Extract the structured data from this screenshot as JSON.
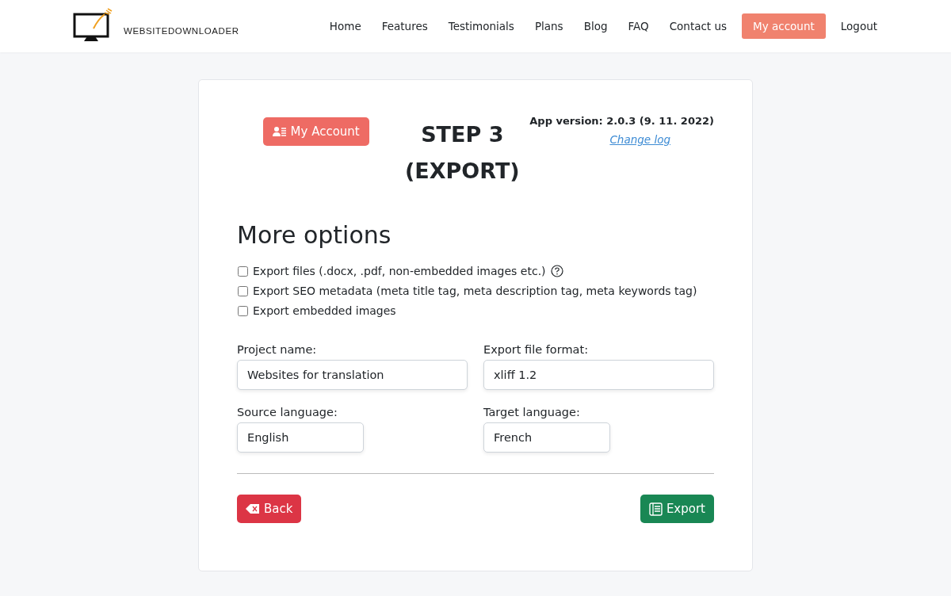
{
  "nav": {
    "logo_text": "WEBSITEDOWNLOADER",
    "links": [
      {
        "label": "Home",
        "selected": false
      },
      {
        "label": "Features",
        "selected": false
      },
      {
        "label": "Testimonials",
        "selected": false
      },
      {
        "label": "Plans",
        "selected": false
      },
      {
        "label": "Blog",
        "selected": false
      },
      {
        "label": "FAQ",
        "selected": false
      },
      {
        "label": "Contact us",
        "selected": false
      },
      {
        "label": "My account",
        "selected": true
      },
      {
        "label": "Logout",
        "selected": false
      }
    ]
  },
  "header": {
    "account_button": "My Account",
    "title": "STEP 3 (EXPORT)",
    "version": "App version: 2.0.3 (9. 11. 2022)",
    "changelog_link": "Change log"
  },
  "heading": "More options",
  "options": [
    {
      "label": "Export files (.docx, .pdf, non-embedded images etc.)",
      "checked": false,
      "help": true
    },
    {
      "label": "Export SEO metadata (meta title tag, meta description tag, meta keywords tag)",
      "checked": false,
      "help": false
    },
    {
      "label": "Export embedded images",
      "checked": false,
      "help": false
    }
  ],
  "fields": [
    {
      "label": "Project name:",
      "value": "Websites for translation",
      "kind": "wide"
    },
    {
      "label": "Export file format:",
      "value": "xliff 1.2",
      "kind": "wide"
    },
    {
      "label": "Source language:",
      "value": "English",
      "kind": "short"
    },
    {
      "label": "Target language:",
      "value": "French",
      "kind": "short"
    }
  ],
  "buttons": {
    "back": "Back",
    "export": "Export"
  }
}
